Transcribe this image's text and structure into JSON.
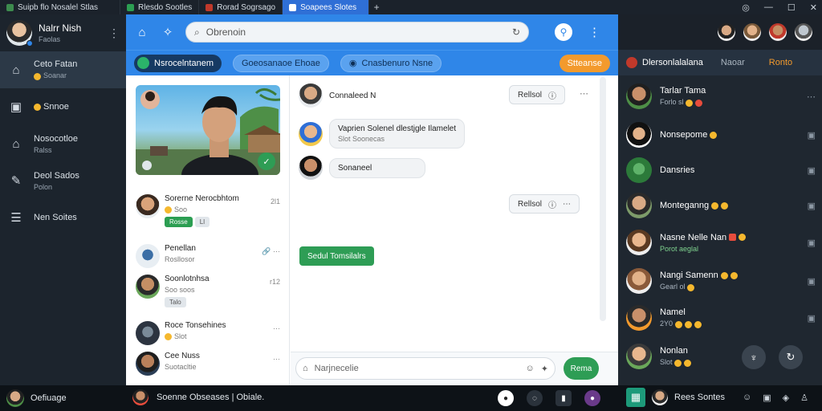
{
  "tabs": [
    {
      "label": "Suipb flo Nosalel Stlas",
      "color": "#3d8b4e"
    },
    {
      "label": "Rlesdo Sootles",
      "color": "#2c9e52"
    },
    {
      "label": "Rorad Sogrsago",
      "color": "#c0392b"
    },
    {
      "label": "Soapees Slotes",
      "color": "#2f6fd6"
    }
  ],
  "sidebar": {
    "profile": {
      "name": "Nalrr Nish",
      "sub": "Faolas"
    },
    "items": [
      {
        "label": "Ceto Fatan",
        "sub": "Soanar"
      },
      {
        "label": "Snnoe",
        "sub": ""
      },
      {
        "label": "Nosocotloe",
        "sub": "Ralss"
      },
      {
        "label": "Deol Sados",
        "sub": "Polon"
      },
      {
        "label": "Nen Soites",
        "sub": ""
      }
    ]
  },
  "search": {
    "placeholder": "Obrenoin"
  },
  "channels": {
    "active": "Nsrocelntanem",
    "chip2": "Goeosanaoe Ehoae",
    "chip3": "Cnasbenuro Nsne",
    "action": "Stteanse"
  },
  "conversations": [
    {
      "name": "Sorerne Nerocbhtom",
      "sub": "Soo",
      "time": "2l1",
      "badge1": "Rosse",
      "badge2": "Ll"
    },
    {
      "name": "Penellan",
      "sub": "Rosllosor",
      "time": ""
    },
    {
      "name": "Soonlotnhsa",
      "sub": "Soo soos",
      "time": "r12",
      "badge2": "Talo"
    },
    {
      "name": "Roce Tonsehines",
      "sub": "Slot",
      "time": ""
    },
    {
      "name": "Cee Nuss",
      "sub": "Suotacltie",
      "time": ""
    }
  ],
  "messages": [
    {
      "text": "Connaleed N"
    },
    {
      "text": "Vaprien Solenel dlestjgle Ilamelet",
      "sub": "Slot Soonecas"
    },
    {
      "text": "Sonaneel"
    }
  ],
  "pills": [
    {
      "text": "Rellsol"
    },
    {
      "text": "Rellsol"
    }
  ],
  "chat_button": "Sedul Tomsilalrs",
  "composer": {
    "placeholder": "Narjnecelie",
    "send": "Rema"
  },
  "rpanel": {
    "title": "Dlersonlalalana",
    "tab2": "Naoar",
    "tab3": "Ronto",
    "contacts": [
      {
        "name": "Tarlar Tama",
        "sub": "Forlo sl"
      },
      {
        "name": "Nonsepome",
        "sub": ""
      },
      {
        "name": "Dansries",
        "sub": ""
      },
      {
        "name": "Monteganng",
        "sub": ""
      },
      {
        "name": "Nasne Nelle Nan",
        "sub": "Porot aeglal"
      },
      {
        "name": "Nangi Samenn",
        "sub": "Gearl ol"
      },
      {
        "name": "Namel",
        "sub": "2Y0"
      },
      {
        "name": "Nonlan",
        "sub": "Slot"
      }
    ]
  },
  "bottombar": {
    "left": "Oefiuage",
    "mid": "Soenne Obseases | Obiale.",
    "right": "Rees Sontes"
  },
  "colors": {
    "header_blue": "#2f86e8",
    "accent_green": "#2e9d55",
    "accent_orange": "#f39a2d",
    "sidebar_bg": "#1c242d"
  }
}
